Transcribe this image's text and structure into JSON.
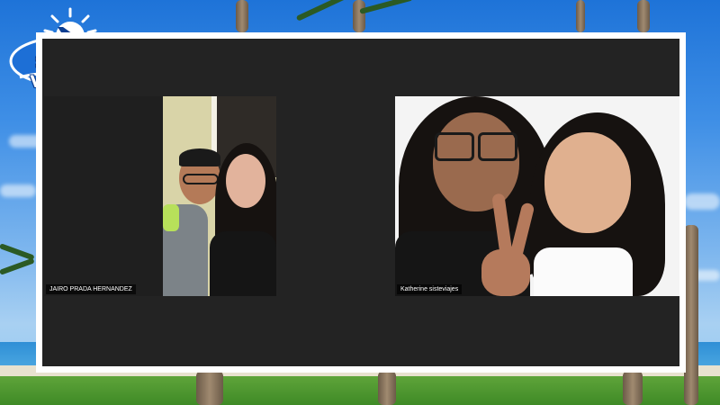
{
  "brand": {
    "name": "SISTE VIAJES"
  },
  "meeting": {
    "participants": [
      {
        "name": "JAIRO PRADA HERNANDEZ"
      },
      {
        "name": "Katherine sisteviajes"
      }
    ]
  },
  "colors": {
    "tile_background": "#232323",
    "frame_border": "#ffffff",
    "logo_blue": "#0b3d91"
  }
}
